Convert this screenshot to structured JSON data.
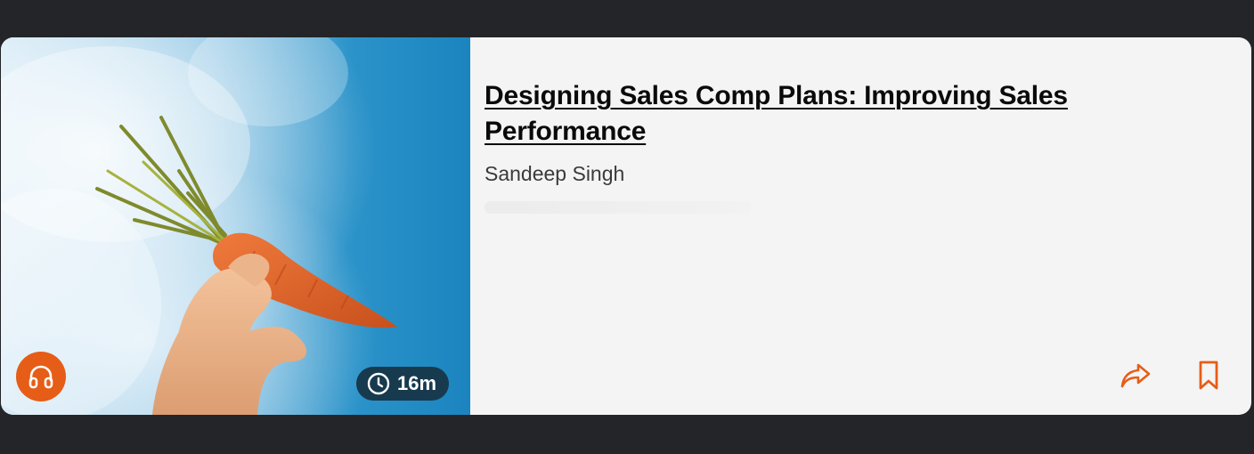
{
  "card": {
    "title": "Designing Sales Comp Plans: Improving Sales Performance",
    "author": "Sandeep Singh",
    "duration": "16m"
  },
  "icons": {
    "audio": "headphones-icon",
    "duration": "clock-icon",
    "share": "share-arrow-icon",
    "bookmark": "bookmark-icon"
  },
  "colors": {
    "accent": "#e65d17",
    "badge_bg": "#173a4e",
    "card_bg": "#f4f4f4",
    "page_bg": "#232528"
  }
}
